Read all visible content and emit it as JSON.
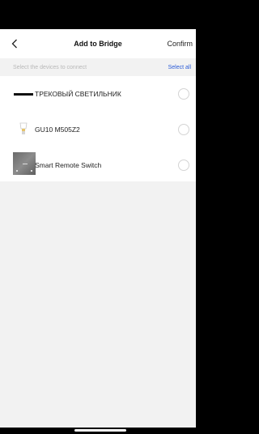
{
  "header": {
    "title": "Add to Bridge",
    "confirm_label": "Confirm",
    "back_icon": "chevron-left-icon"
  },
  "subbar": {
    "hint": "Select the devices to connect",
    "select_all_label": "Select all",
    "select_all_color": "#2a5bd7"
  },
  "devices": [
    {
      "label": "ТРЕКОВЫЙ СВЕТИЛЬНИК",
      "thumbnail": "track-light-thumbnail",
      "selected": false
    },
    {
      "label": "GU10 M505Z2",
      "thumbnail": "bulb-icon",
      "selected": false
    },
    {
      "label": "Smart Remote Switch",
      "thumbnail": "remote-switch-thumbnail",
      "selected": false
    }
  ]
}
